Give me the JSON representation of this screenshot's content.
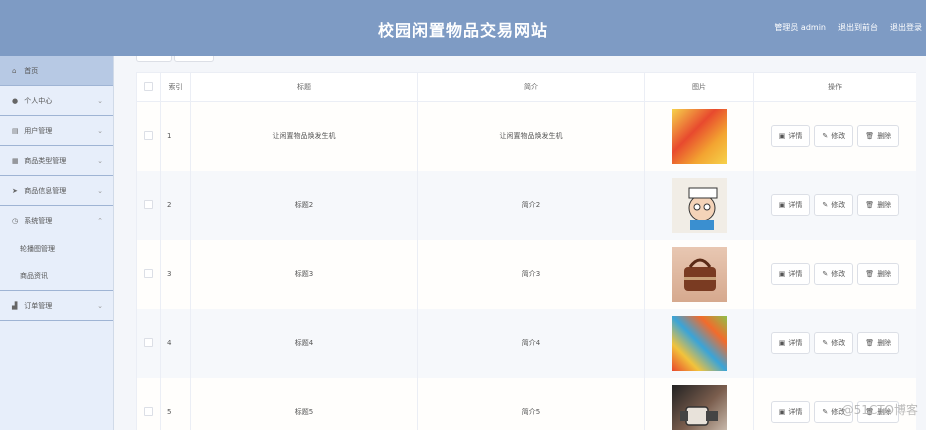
{
  "header": {
    "title": "校园闲置物品交易网站",
    "admin_label": "管理员 admin",
    "front_link": "退出到前台",
    "logout_link": "退出登录",
    "bg_color": "#7e9bc4"
  },
  "sidebar": {
    "items": [
      {
        "label": "首页",
        "icon": "home-icon"
      },
      {
        "label": "个人中心",
        "icon": "user-icon"
      },
      {
        "label": "用户管理",
        "icon": "document-icon"
      },
      {
        "label": "商品类型管理",
        "icon": "grid-icon"
      },
      {
        "label": "商品信息管理",
        "icon": "send-icon"
      },
      {
        "label": "系统管理",
        "icon": "clock-icon"
      },
      {
        "label": "订单管理",
        "icon": "chart-icon"
      }
    ],
    "sub_items": [
      "轮播图管理",
      "商品资讯"
    ]
  },
  "table": {
    "columns": [
      "索引",
      "标题",
      "简介",
      "图片",
      "操作"
    ],
    "rows": [
      {
        "index": "1",
        "title": "让闲置物品焕发生机",
        "intro": "让闲置物品焕发生机",
        "image": "snack-bag"
      },
      {
        "index": "2",
        "title": "标题2",
        "intro": "简介2",
        "image": "cartoon-sticker"
      },
      {
        "index": "3",
        "title": "标题3",
        "intro": "简介3",
        "image": "leather-bag"
      },
      {
        "index": "4",
        "title": "标题4",
        "intro": "简介4",
        "image": "colorful-snacks"
      },
      {
        "index": "5",
        "title": "标题5",
        "intro": "简介5",
        "image": "wristwatch"
      }
    ],
    "actions": {
      "detail": "详情",
      "edit": "修改",
      "delete": "删除"
    }
  },
  "watermark": "@51CTO博客"
}
